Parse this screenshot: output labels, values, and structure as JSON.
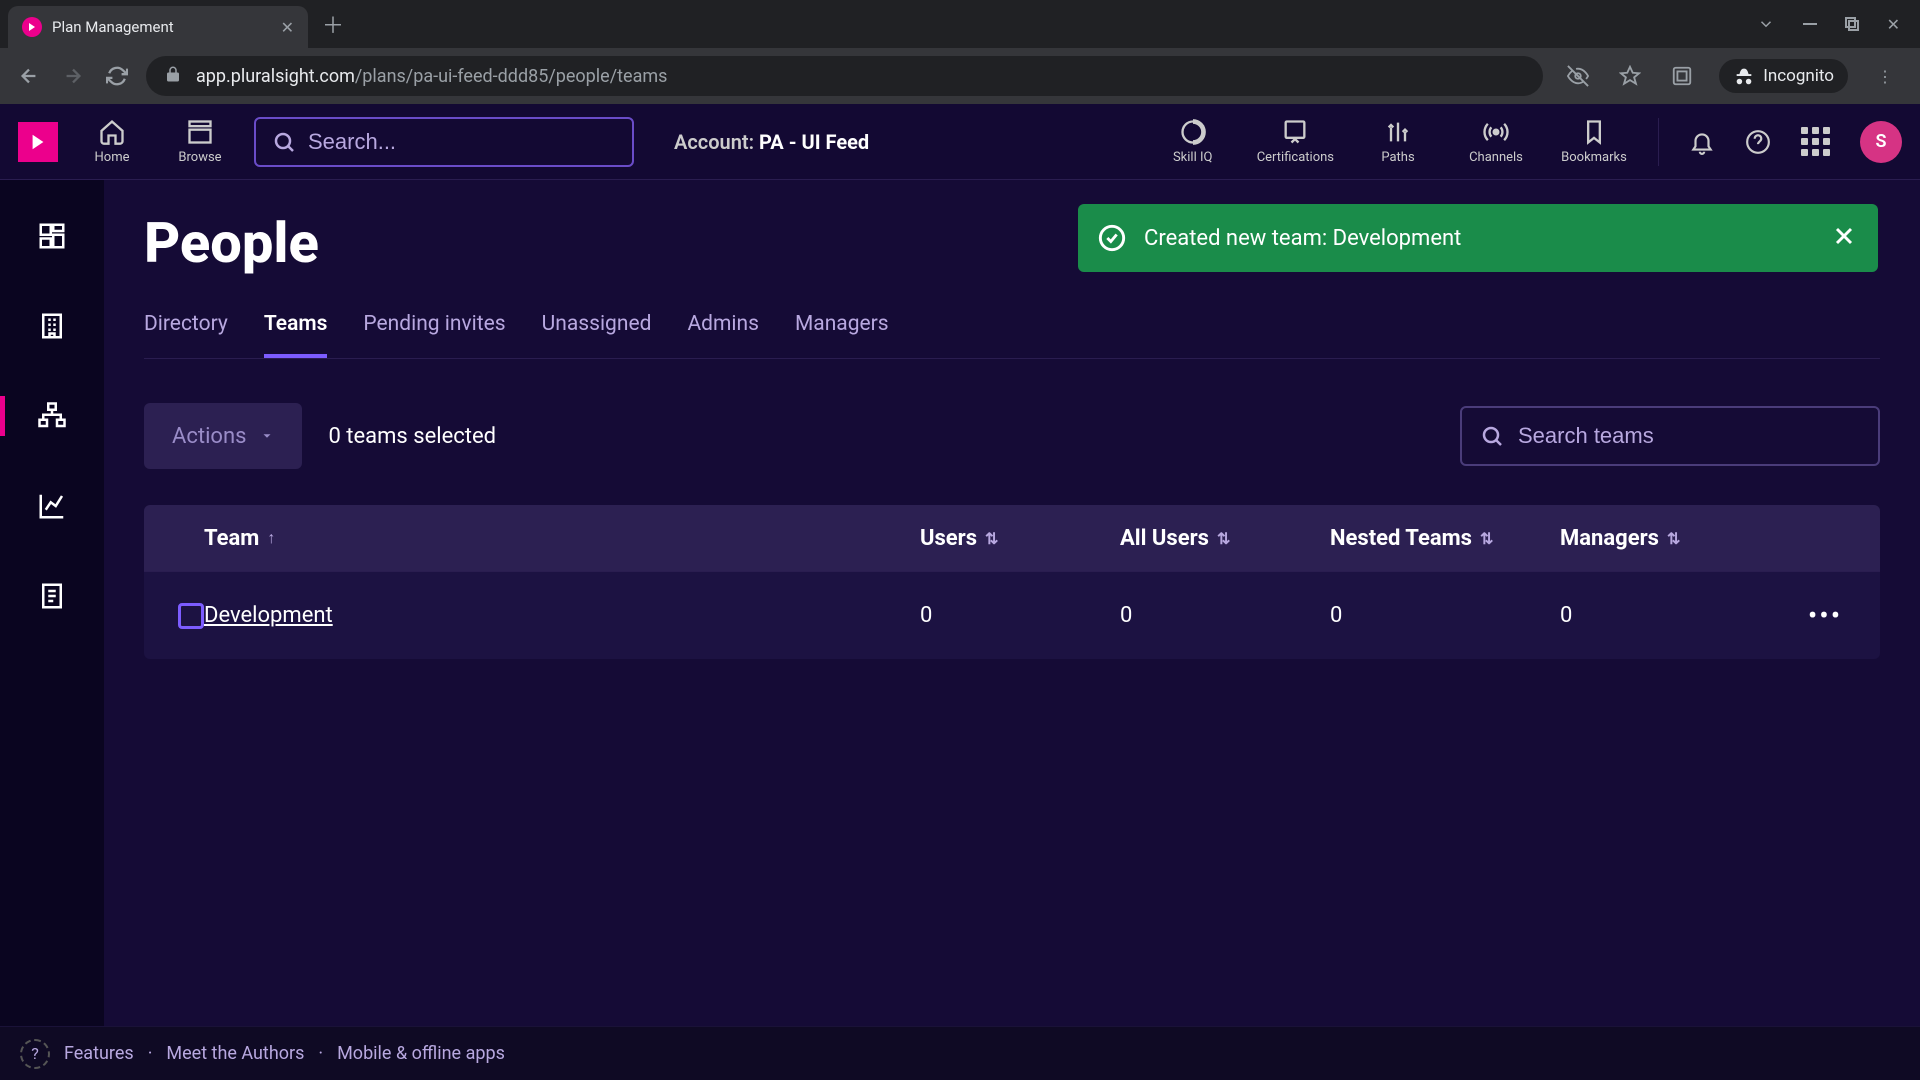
{
  "browser": {
    "tab_title": "Plan Management",
    "url_host": "app.pluralsight.com",
    "url_path": "/plans/pa-ui-feed-ddd85/people/teams",
    "incognito_label": "Incognito"
  },
  "topnav": {
    "items": [
      {
        "label": "Home"
      },
      {
        "label": "Browse"
      },
      {
        "label": "Skill IQ"
      },
      {
        "label": "Certifications"
      },
      {
        "label": "Paths"
      },
      {
        "label": "Channels"
      },
      {
        "label": "Bookmarks"
      }
    ],
    "search_placeholder": "Search...",
    "account_prefix": "Account:",
    "account_name": "PA - UI Feed",
    "avatar_initial": "S"
  },
  "toast": {
    "message": "Created new team: Development"
  },
  "page": {
    "title": "People",
    "tabs": [
      "Directory",
      "Teams",
      "Pending invites",
      "Unassigned",
      "Admins",
      "Managers"
    ],
    "active_tab": "Teams"
  },
  "toolbar": {
    "actions_label": "Actions",
    "selected_text": "0 teams selected",
    "search_placeholder": "Search teams"
  },
  "table": {
    "columns": [
      "Team",
      "Users",
      "All Users",
      "Nested Teams",
      "Managers"
    ],
    "rows": [
      {
        "team": "Development",
        "users": "0",
        "all_users": "0",
        "nested_teams": "0",
        "managers": "0"
      }
    ]
  },
  "footer": {
    "links": [
      "Features",
      "Meet the Authors",
      "Mobile & offline apps"
    ]
  }
}
